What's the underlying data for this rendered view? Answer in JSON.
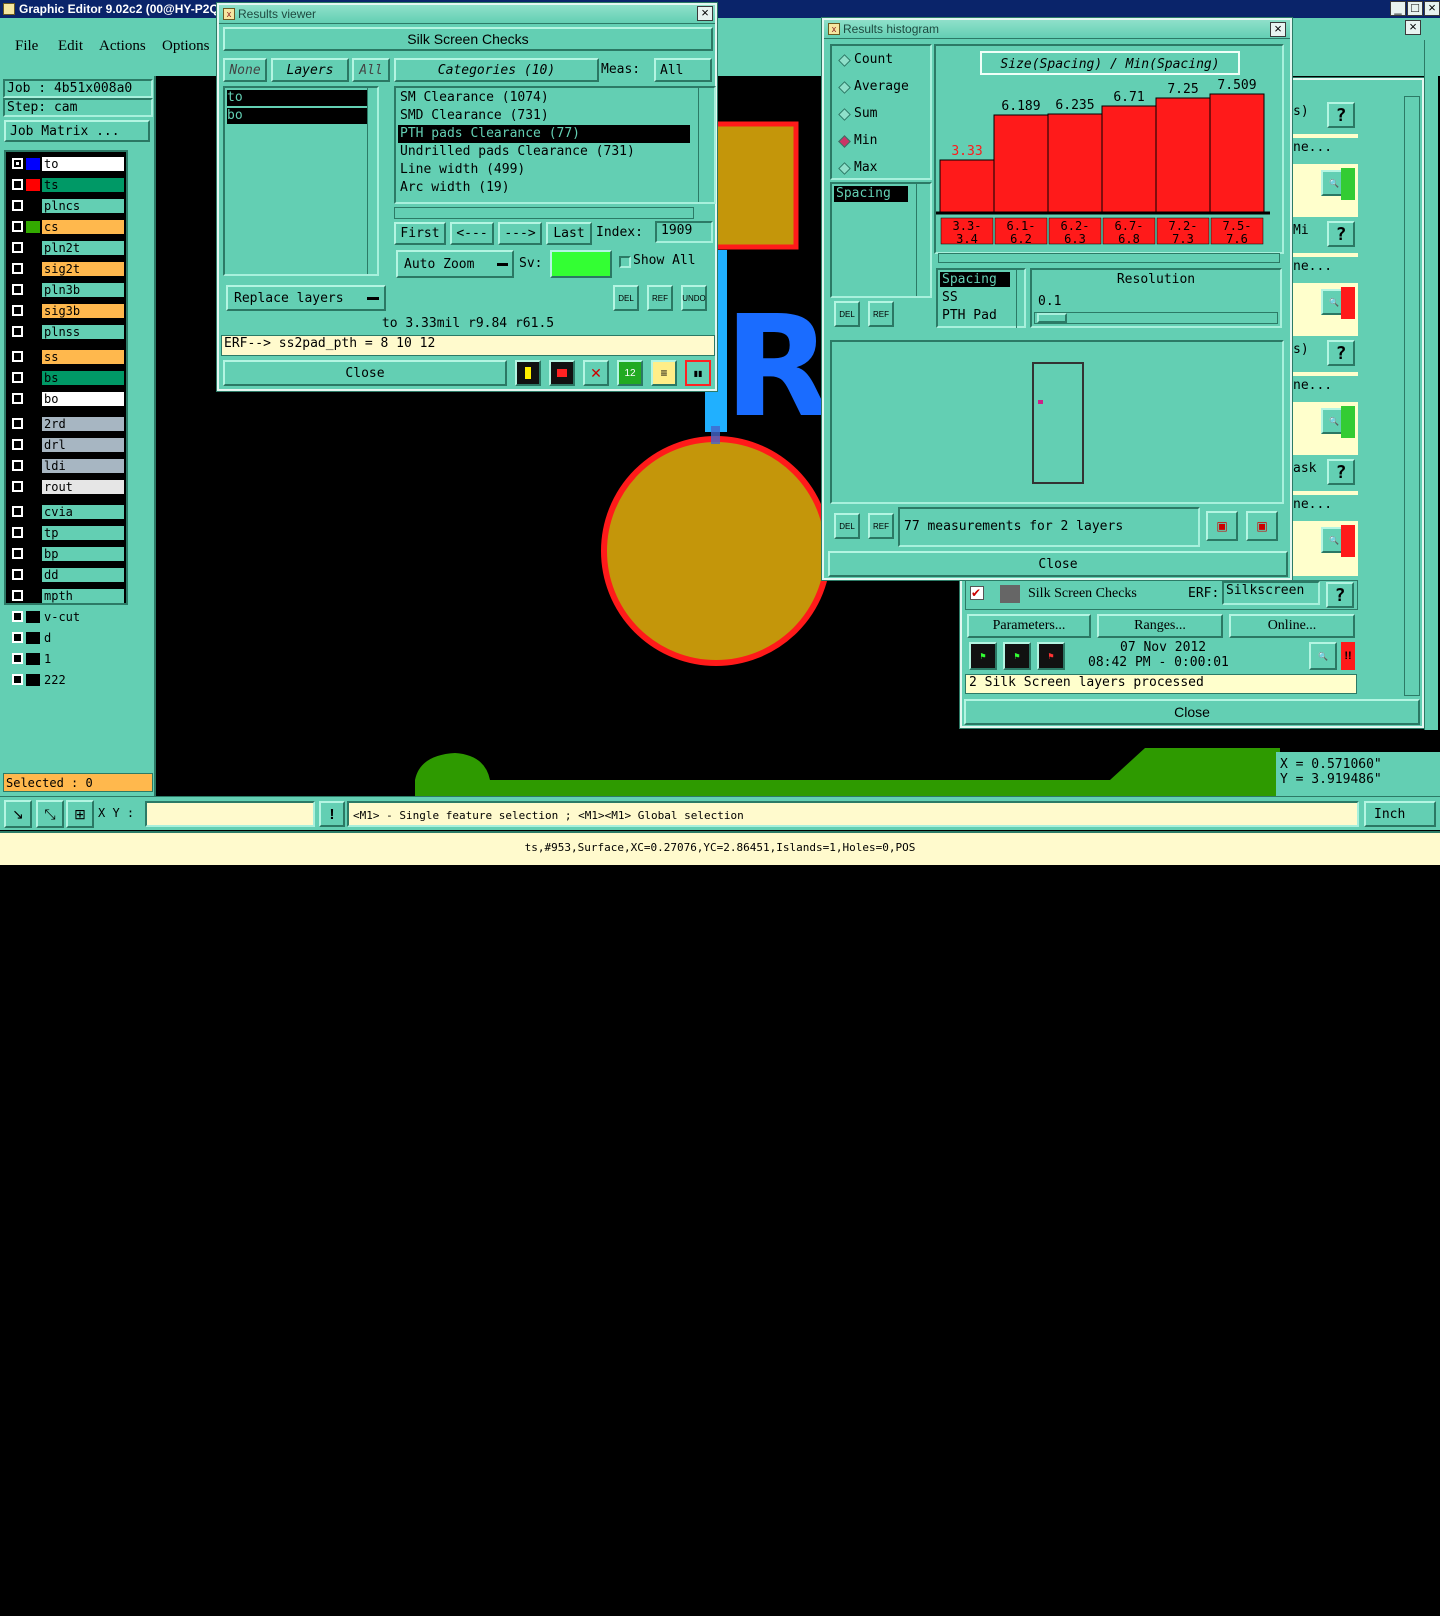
{
  "app": {
    "title": "Graphic Editor 9.02c2 (00@HY-P2Q/"
  },
  "menu": [
    "File",
    "Edit",
    "Actions",
    "Options"
  ],
  "job": {
    "job_label": "Job : 4b51x008a0",
    "step_label": "Step: cam",
    "matrix_button": "Job Matrix ..."
  },
  "layers": [
    {
      "name": "to",
      "color": "#ffffff",
      "swatch": "#0000ff"
    },
    {
      "name": "ts",
      "color": "#009966",
      "swatch": "#ff0000"
    },
    {
      "name": "plncs",
      "color": "#63cfb3",
      "swatch": ""
    },
    {
      "name": "cs",
      "color": "#ffb84d",
      "swatch": "#33aa00"
    },
    {
      "name": "pln2t",
      "color": "#63cfb3",
      "swatch": ""
    },
    {
      "name": "sig2t",
      "color": "#ffb84d",
      "swatch": ""
    },
    {
      "name": "pln3b",
      "color": "#63cfb3",
      "swatch": ""
    },
    {
      "name": "sig3b",
      "color": "#ffb84d",
      "swatch": ""
    },
    {
      "name": "plnss",
      "color": "#63cfb3",
      "swatch": ""
    },
    {
      "name": "ss",
      "color": "#ffb84d",
      "swatch": ""
    },
    {
      "name": "bs",
      "color": "#009966",
      "swatch": ""
    },
    {
      "name": "bo",
      "color": "#ffffff",
      "swatch": ""
    },
    {
      "name": "2rd",
      "color": "#a7b6c2",
      "swatch": ""
    },
    {
      "name": "drl",
      "color": "#a7b6c2",
      "swatch": ""
    },
    {
      "name": "ldi",
      "color": "#a7b6c2",
      "swatch": ""
    },
    {
      "name": "rout",
      "color": "#e6e6e6",
      "swatch": ""
    },
    {
      "name": "cvia",
      "color": "#63cfb3",
      "swatch": ""
    },
    {
      "name": "tp",
      "color": "#63cfb3",
      "swatch": ""
    },
    {
      "name": "bp",
      "color": "#63cfb3",
      "swatch": ""
    },
    {
      "name": "dd",
      "color": "#63cfb3",
      "swatch": ""
    },
    {
      "name": "mpth",
      "color": "#63cfb3",
      "swatch": ""
    },
    {
      "name": "v-cut",
      "color": "#63cfb3",
      "swatch": ""
    },
    {
      "name": "d",
      "color": "#63cfb3",
      "swatch": ""
    },
    {
      "name": "1",
      "color": "#63cfb3",
      "swatch": ""
    },
    {
      "name": "222",
      "color": "#63cfb3",
      "swatch": ""
    }
  ],
  "selected": "Selected : 0",
  "canvas_text": "R:",
  "results_viewer": {
    "title": "Results viewer",
    "header": "Silk Screen Checks",
    "none_btn": "None",
    "layers_btn": "Layers",
    "all_btn": "All",
    "categories_btn": "Categories (10)",
    "meas_label": "Meas:",
    "meas_value": "All",
    "layer_list": [
      "to",
      "bo"
    ],
    "categories": [
      "SM Clearance (1074)",
      "SMD Clearance (731)",
      "PTH pads Clearance (77)",
      "Undrilled pads Clearance (731)",
      "Line width (499)",
      "Arc width (19)"
    ],
    "selected_category": 2,
    "nav": [
      "First",
      "<---",
      "--->",
      "Last"
    ],
    "index_label": "Index:",
    "index_value": "1909",
    "auto_zoom": "Auto Zoom",
    "sv_label": "Sv:",
    "show_all": "Show All",
    "replace_layers": "Replace layers",
    "icons": [
      "DEL",
      "REF",
      "UNDO"
    ],
    "status": "to 3.33mil  r9.84  r61.5",
    "erf": "ERF--> ss2pad_pth = 8 10 12",
    "close": "Close"
  },
  "histogram": {
    "title": "Results histogram",
    "modes": [
      "Count",
      "Average",
      "Sum",
      "Min",
      "Max"
    ],
    "selected_mode": "Min",
    "chart_title": "Size(Spacing) / Min(Spacing)",
    "measure_list": [
      "Spacing"
    ],
    "measure_list2": [
      "Spacing",
      "SS",
      "PTH Pad"
    ],
    "resolution_label": "Resolution",
    "resolution_value": "0.1",
    "summary": "77 measurements for 2 layers",
    "close": "Close"
  },
  "chart_data": {
    "type": "bar",
    "title": "Size(Spacing) / Min(Spacing)",
    "categories": [
      "3.3-3.4",
      "6.1-6.2",
      "6.2-6.3",
      "6.7-6.8",
      "7.2-7.3",
      "7.5-7.6"
    ],
    "values": [
      3.33,
      6.189,
      6.235,
      6.71,
      7.25,
      7.509
    ],
    "value_labels": [
      "3.33",
      "6.189",
      "6.235",
      "6.71",
      "7.25",
      "7.509"
    ],
    "ylim": [
      0,
      8
    ]
  },
  "checklist": {
    "rows": [
      {
        "label": "s)"
      },
      {
        "label": "ne..."
      },
      {
        "label": "Mi"
      },
      {
        "label": "ne..."
      },
      {
        "label": "s)"
      },
      {
        "label": "ne..."
      },
      {
        "label": "ask"
      },
      {
        "label": "ne..."
      }
    ],
    "check_name": "Silk Screen Checks",
    "erf_label": "ERF:",
    "erf_value": "Silkscreen",
    "params": "Parameters...",
    "ranges": "Ranges...",
    "online": "Online...",
    "date": "07 Nov 2012",
    "time": "08:42 PM - 0:00:01",
    "status": "2 Silk Screen layers processed",
    "close": "Close"
  },
  "coords": {
    "x": "X = 0.571060\"",
    "y": "Y = 3.919486\""
  },
  "bottom": {
    "xy_label": "X Y :",
    "hint": "<M1> - Single feature selection ; <M1><M1> Global selection",
    "units": "Inch",
    "info": "ts,#953,Surface,XC=0.27076,YC=2.86451,Islands=1,Holes=0,POS"
  }
}
